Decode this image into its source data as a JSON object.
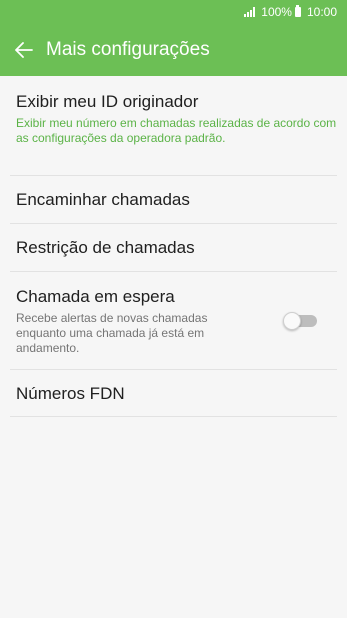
{
  "colors": {
    "accent": "#6cbf55",
    "subtitle_accent": "#5bb347"
  },
  "status_bar": {
    "signal_icon": "signal-icon",
    "battery_percent": "100%",
    "battery_icon": "battery-icon",
    "time": "10:00"
  },
  "header": {
    "back_icon": "arrow-left-icon",
    "title": "Mais configurações"
  },
  "settings": [
    {
      "title": "Exibir meu ID originador",
      "subtitle": "Exibir meu número em chamadas realizadas de acordo com as configurações da operadora padrão."
    },
    {
      "title": "Encaminhar chamadas"
    },
    {
      "title": "Restrição de chamadas"
    },
    {
      "title": "Chamada em espera",
      "subtitle": "Recebe alertas de novas chamadas enquanto uma chamada já está em andamento.",
      "toggle_on": false
    },
    {
      "title": "Números FDN"
    }
  ]
}
